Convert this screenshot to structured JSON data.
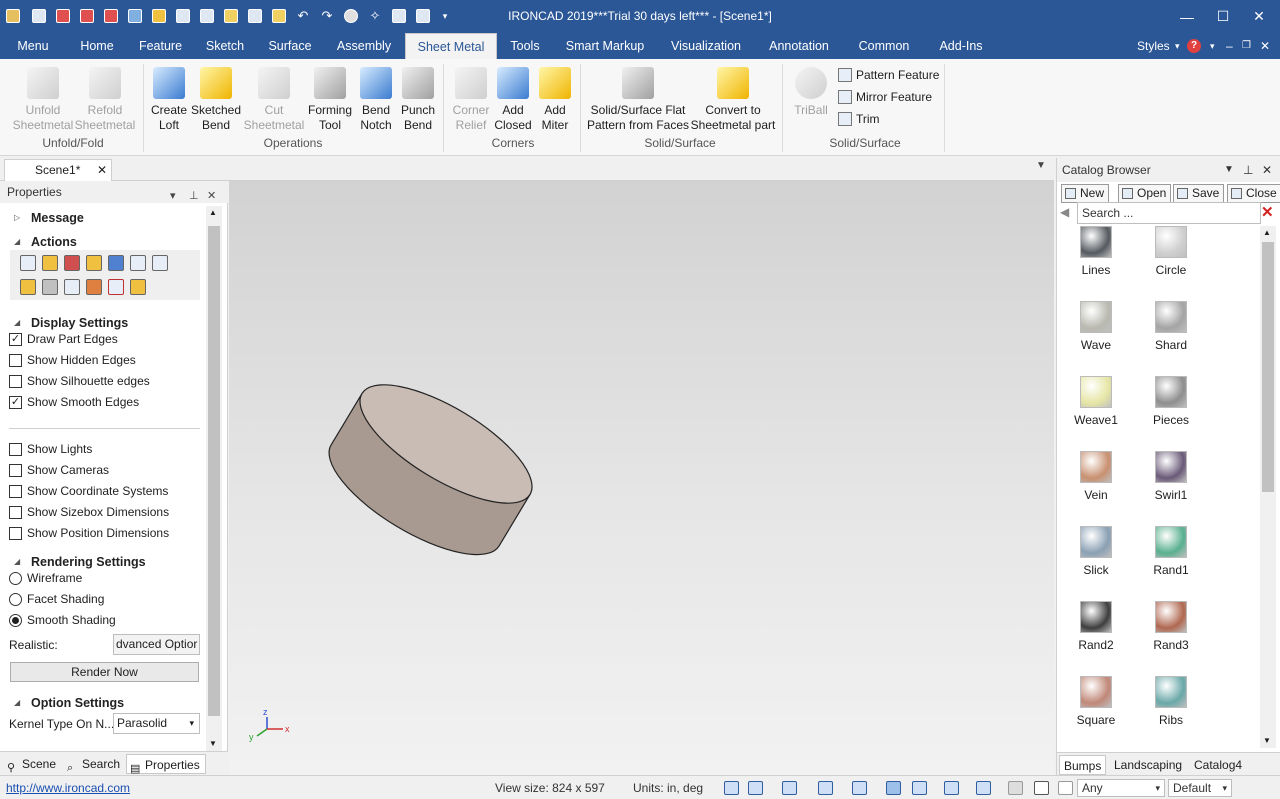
{
  "window": {
    "title": "IRONCAD 2019***Trial 30 days left*** - [Scene1*]",
    "minimize": "—",
    "maximize": "☐",
    "close": "✕"
  },
  "menu_tabs": [
    "Menu",
    "Home",
    "Feature",
    "Sketch",
    "Surface",
    "Assembly",
    "Sheet Metal",
    "Tools",
    "Smart Markup",
    "Visualization",
    "Annotation",
    "Common",
    "Add-Ins"
  ],
  "active_tab": "Sheet Metal",
  "styles_label": "Styles",
  "ribbon": {
    "unfold": {
      "line1": "Unfold",
      "line2": "Sheetmetal"
    },
    "refold": {
      "line1": "Refold",
      "line2": "Sheetmetal"
    },
    "group_unfold": "Unfold/Fold",
    "create_loft": {
      "line1": "Create",
      "line2": "Loft"
    },
    "sketched_bend": {
      "line1": "Sketched",
      "line2": "Bend"
    },
    "cut_sheetmetal": {
      "line1": "Cut",
      "line2": "Sheetmetal"
    },
    "forming_tool": {
      "line1": "Forming",
      "line2": "Tool"
    },
    "bend_notch": {
      "line1": "Bend",
      "line2": "Notch"
    },
    "punch_bend": {
      "line1": "Punch",
      "line2": "Bend"
    },
    "group_operations": "Operations",
    "corner_relief": {
      "line1": "Corner",
      "line2": "Relief"
    },
    "add_closed": {
      "line1": "Add",
      "line2": "Closed"
    },
    "add_miter": {
      "line1": "Add",
      "line2": "Miter"
    },
    "group_corners": "Corners",
    "solid_surface_flat": {
      "line1": "Solid/Surface Flat",
      "line2": "Pattern from Faces"
    },
    "convert_to_sheetmetal": {
      "line1": "Convert to",
      "line2": "Sheetmetal part"
    },
    "group_solid_surface": "Solid/Surface",
    "triball": {
      "line1": "TriBall",
      "line2": ""
    },
    "pattern_feature": "Pattern Feature",
    "mirror_feature": "Mirror Feature",
    "trim": "Trim",
    "group_solid_surface2": "Solid/Surface"
  },
  "doc_tab": "Scene1*",
  "properties": {
    "title": "Properties",
    "message": "Message",
    "actions": "Actions",
    "display_settings": "Display Settings",
    "checks": [
      {
        "label": "Draw Part Edges",
        "checked": true
      },
      {
        "label": "Show Hidden Edges",
        "checked": false
      },
      {
        "label": "Show Silhouette edges",
        "checked": false
      },
      {
        "label": "Show Smooth Edges",
        "checked": true
      }
    ],
    "checks2": [
      {
        "label": "Show Lights",
        "checked": false
      },
      {
        "label": "Show Cameras",
        "checked": false
      },
      {
        "label": "Show Coordinate Systems",
        "checked": false
      },
      {
        "label": "Show Sizebox Dimensions",
        "checked": false
      },
      {
        "label": "Show Position Dimensions",
        "checked": false
      }
    ],
    "rendering_settings": "Rendering Settings",
    "radios": [
      {
        "label": "Wireframe",
        "selected": false
      },
      {
        "label": "Facet Shading",
        "selected": false
      },
      {
        "label": "Smooth Shading",
        "selected": true
      }
    ],
    "realistic_label": "Realistic:",
    "realistic_value": "dvanced Optior",
    "render_now": "Render Now",
    "option_settings": "Option Settings",
    "kernel_label": "Kernel Type On N...",
    "kernel_value": "Parasolid",
    "bottom_tabs": [
      "Scene",
      "Search",
      "Properties"
    ],
    "active_bottom": "Properties"
  },
  "axis_labels": {
    "z": "z",
    "x": "x",
    "y": "y"
  },
  "catalog": {
    "title": "Catalog Browser",
    "buttons": [
      "New",
      "Open",
      "Save",
      "Close"
    ],
    "search_placeholder": "Search ...",
    "items": [
      "Lines",
      "Circle",
      "Wave",
      "Shard",
      "Weave1",
      "Pieces",
      "Vein",
      "Swirl1",
      "Slick",
      "Rand1",
      "Rand2",
      "Rand3",
      "Square",
      "Ribs"
    ],
    "tabs": [
      "Bumps",
      "Landscaping",
      "Catalog4"
    ],
    "active_tab": "Bumps"
  },
  "status": {
    "link": "http://www.ironcad.com",
    "view_size": "View size:  824 x  597",
    "units": "Units: in, deg",
    "filter_value": "Any",
    "default_value": "Default"
  },
  "colors": {
    "titlebar": "#2b5797",
    "part_top": "#c9bcb4",
    "part_side": "#a89a90"
  }
}
